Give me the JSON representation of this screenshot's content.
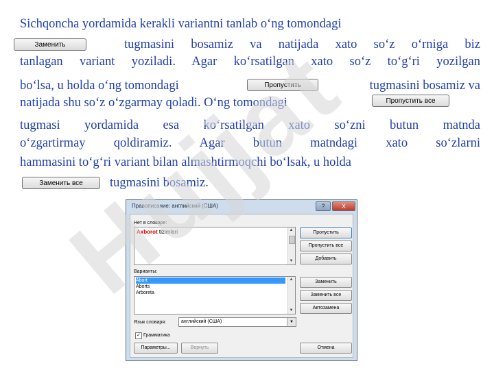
{
  "paragraph": {
    "l1": "Sichqoncha yordamida kerakli variantni tanlab o‘ng tomondagi",
    "l2": "tugmasini bosamiz va natijada xato so‘z o‘rniga biz",
    "l3": "tanlagan variant yoziladi. Agar ko‘rsatilgan xato so‘z to‘g‘ri yozilgan",
    "l4a": "bo‘lsa, u holda o‘ng tomondagi",
    "l4b": "tugmasini bosamiz va",
    "l5": "natijada shu so‘z o‘zgarmay qoladi. O‘ng tomondagi",
    "l6": "tugmasi yordamida esa ko‘rsatilgan xato so‘zni butun matnda",
    "l7": "o‘zgartirmay qoldiramiz. Agar butun matndagi xato so‘zlarni",
    "l8": "hammasini to‘g‘ri variant bilan almashtirmoqchi bo‘lsak, u holda",
    "l9": "tugmasini bosamiz."
  },
  "inline_buttons": {
    "replace": "Заменить",
    "skip": "Пропустить",
    "skip_all": "Пропустить все",
    "replace_all": "Заменить все"
  },
  "dialog": {
    "title": "Правописание: английский (США)",
    "help": "?",
    "close": "X",
    "not_in_dict_label": "Нет в словаре:",
    "error_word": "Axborot",
    "rest_text": " tizimlari",
    "suggestions_label": "Варианты:",
    "suggestions": [
      "Abort",
      "Aborts",
      "Arboreta"
    ],
    "buttons": {
      "skip": "Пропустить",
      "skip_all": "Пропустить все",
      "add": "Добавить",
      "change": "Заменить",
      "change_all": "Заменить все",
      "autocorrect": "Автозамена"
    },
    "lang_label": "Язык словаря:",
    "lang_value": "английский (США)",
    "grammar_label": "Грамматика",
    "options": "Параметры...",
    "undo": "Вернуть",
    "cancel": "Отмена",
    "colors": {
      "error": "#d00000",
      "selection": "#3399ff"
    }
  },
  "watermark": "Hujjat"
}
